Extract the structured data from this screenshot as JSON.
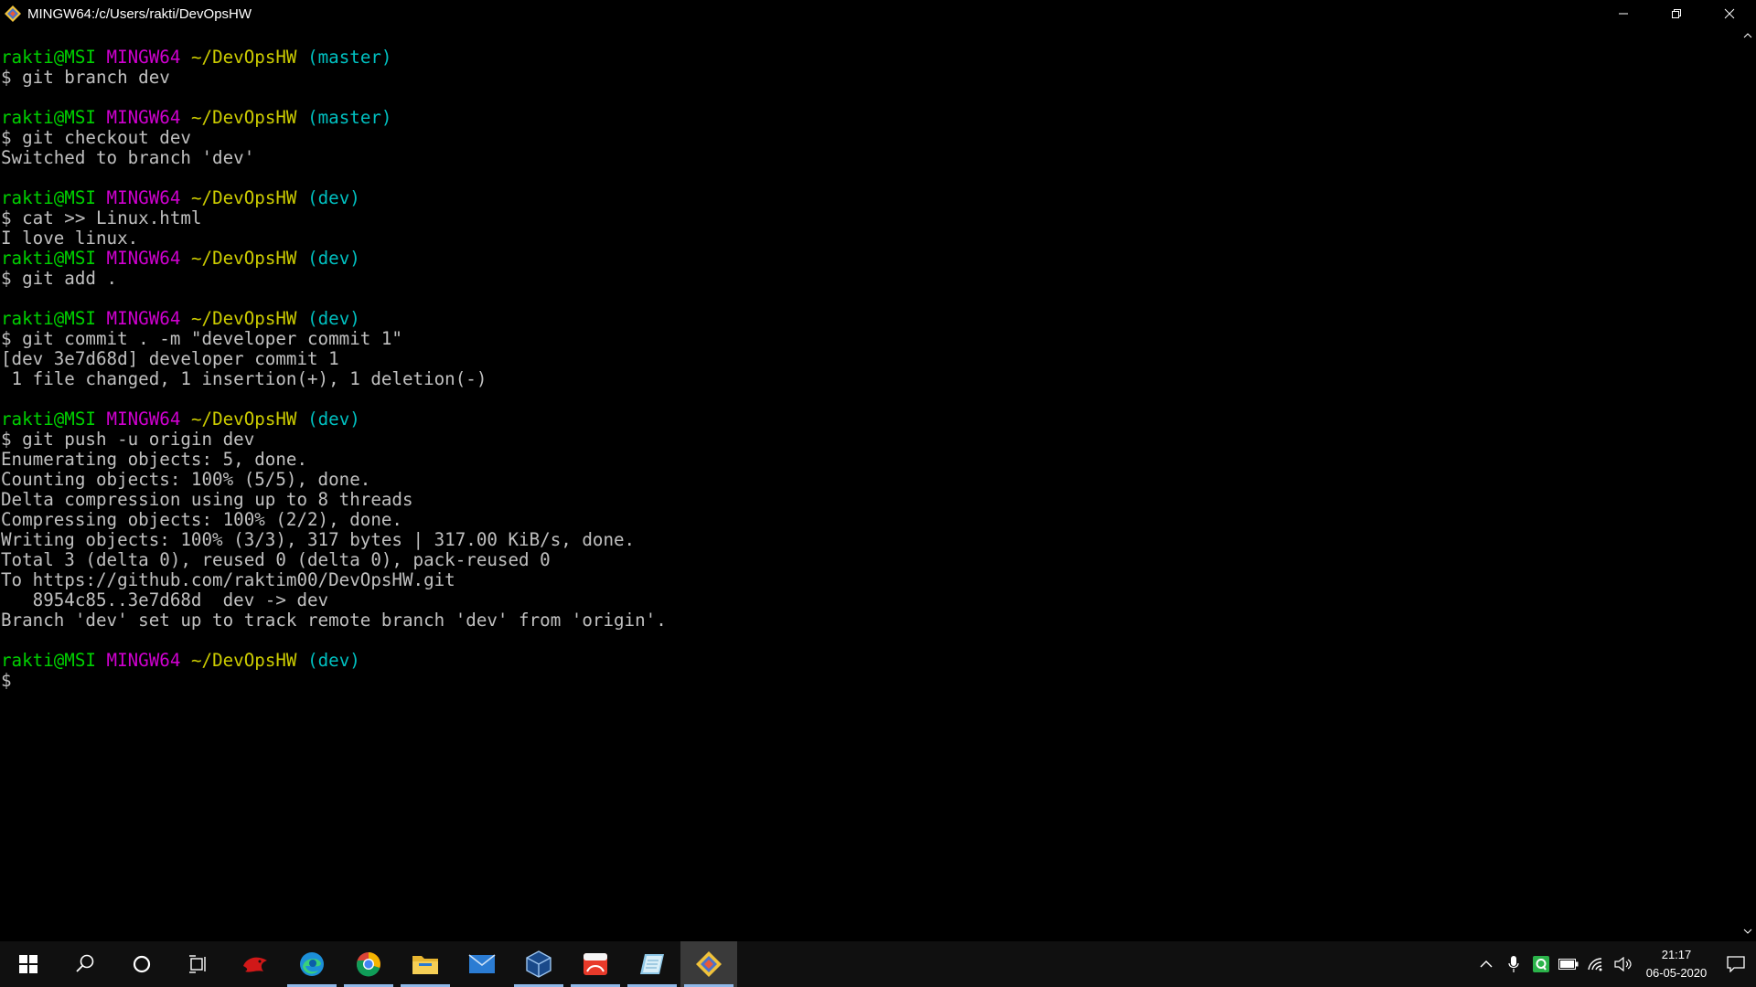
{
  "window": {
    "title": "MINGW64:/c/Users/rakti/DevOpsHW"
  },
  "terminal": {
    "lines": [
      {
        "type": "prompt",
        "user": "rakti@MSI",
        "system": "MINGW64",
        "path": "~/DevOpsHW",
        "branch": "(master)"
      },
      {
        "type": "text",
        "text": "$ git branch dev"
      },
      {
        "type": "blank",
        "text": ""
      },
      {
        "type": "prompt",
        "user": "rakti@MSI",
        "system": "MINGW64",
        "path": "~/DevOpsHW",
        "branch": "(master)"
      },
      {
        "type": "text",
        "text": "$ git checkout dev"
      },
      {
        "type": "text",
        "text": "Switched to branch 'dev'"
      },
      {
        "type": "blank",
        "text": ""
      },
      {
        "type": "prompt",
        "user": "rakti@MSI",
        "system": "MINGW64",
        "path": "~/DevOpsHW",
        "branch": "(dev)"
      },
      {
        "type": "text",
        "text": "$ cat >> Linux.html"
      },
      {
        "type": "text",
        "text": "I love linux."
      },
      {
        "type": "prompt",
        "user": "rakti@MSI",
        "system": "MINGW64",
        "path": "~/DevOpsHW",
        "branch": "(dev)"
      },
      {
        "type": "text",
        "text": "$ git add ."
      },
      {
        "type": "blank",
        "text": ""
      },
      {
        "type": "prompt",
        "user": "rakti@MSI",
        "system": "MINGW64",
        "path": "~/DevOpsHW",
        "branch": "(dev)"
      },
      {
        "type": "text",
        "text": "$ git commit . -m \"developer commit 1\""
      },
      {
        "type": "text",
        "text": "[dev 3e7d68d] developer commit 1"
      },
      {
        "type": "text",
        "text": " 1 file changed, 1 insertion(+), 1 deletion(-)"
      },
      {
        "type": "blank",
        "text": ""
      },
      {
        "type": "prompt",
        "user": "rakti@MSI",
        "system": "MINGW64",
        "path": "~/DevOpsHW",
        "branch": "(dev)"
      },
      {
        "type": "text",
        "text": "$ git push -u origin dev"
      },
      {
        "type": "text",
        "text": "Enumerating objects: 5, done."
      },
      {
        "type": "text",
        "text": "Counting objects: 100% (5/5), done."
      },
      {
        "type": "text",
        "text": "Delta compression using up to 8 threads"
      },
      {
        "type": "text",
        "text": "Compressing objects: 100% (2/2), done."
      },
      {
        "type": "text",
        "text": "Writing objects: 100% (3/3), 317 bytes | 317.00 KiB/s, done."
      },
      {
        "type": "text",
        "text": "Total 3 (delta 0), reused 0 (delta 0), pack-reused 0"
      },
      {
        "type": "text",
        "text": "To https://github.com/raktim00/DevOpsHW.git"
      },
      {
        "type": "text",
        "text": "   8954c85..3e7d68d  dev -> dev"
      },
      {
        "type": "text",
        "text": "Branch 'dev' set up to track remote branch 'dev' from 'origin'."
      },
      {
        "type": "blank",
        "text": ""
      },
      {
        "type": "prompt",
        "user": "rakti@MSI",
        "system": "MINGW64",
        "path": "~/DevOpsHW",
        "branch": "(dev)"
      },
      {
        "type": "text",
        "text": "$"
      }
    ]
  },
  "taskbar": {
    "apps": [
      {
        "name": "start-button",
        "icon": "windows-logo-icon",
        "active": false
      },
      {
        "name": "search-button",
        "icon": "search-icon",
        "active": false
      },
      {
        "name": "cortana-button",
        "icon": "cortana-ring-icon",
        "active": false
      },
      {
        "name": "task-view-button",
        "icon": "task-view-icon",
        "active": false
      },
      {
        "name": "taskbar-app-msi-dragon",
        "icon": "msi-dragon-icon",
        "active": false
      },
      {
        "name": "taskbar-app-edge",
        "icon": "edge-icon",
        "active": false,
        "running": true
      },
      {
        "name": "taskbar-app-chrome",
        "icon": "chrome-icon",
        "active": false,
        "running": true
      },
      {
        "name": "taskbar-app-file-explorer",
        "icon": "folder-icon",
        "active": false,
        "running": true
      },
      {
        "name": "taskbar-app-mail",
        "icon": "mail-icon",
        "active": false
      },
      {
        "name": "taskbar-app-virtualbox",
        "icon": "virtualbox-icon",
        "active": false,
        "running": true
      },
      {
        "name": "taskbar-app-red-app",
        "icon": "red-app-icon",
        "active": false,
        "running": true
      },
      {
        "name": "taskbar-app-notepad",
        "icon": "notepad-icon",
        "active": false,
        "running": true
      },
      {
        "name": "taskbar-app-git-bash",
        "icon": "git-icon",
        "active": true,
        "running": true
      }
    ],
    "clock": {
      "time": "21:17",
      "date": "06-05-2020"
    }
  },
  "colors": {
    "user": "#00d000",
    "system": "#d000d0",
    "path": "#cccc00",
    "branch": "#00c0c0",
    "text": "#c0c0c0"
  }
}
